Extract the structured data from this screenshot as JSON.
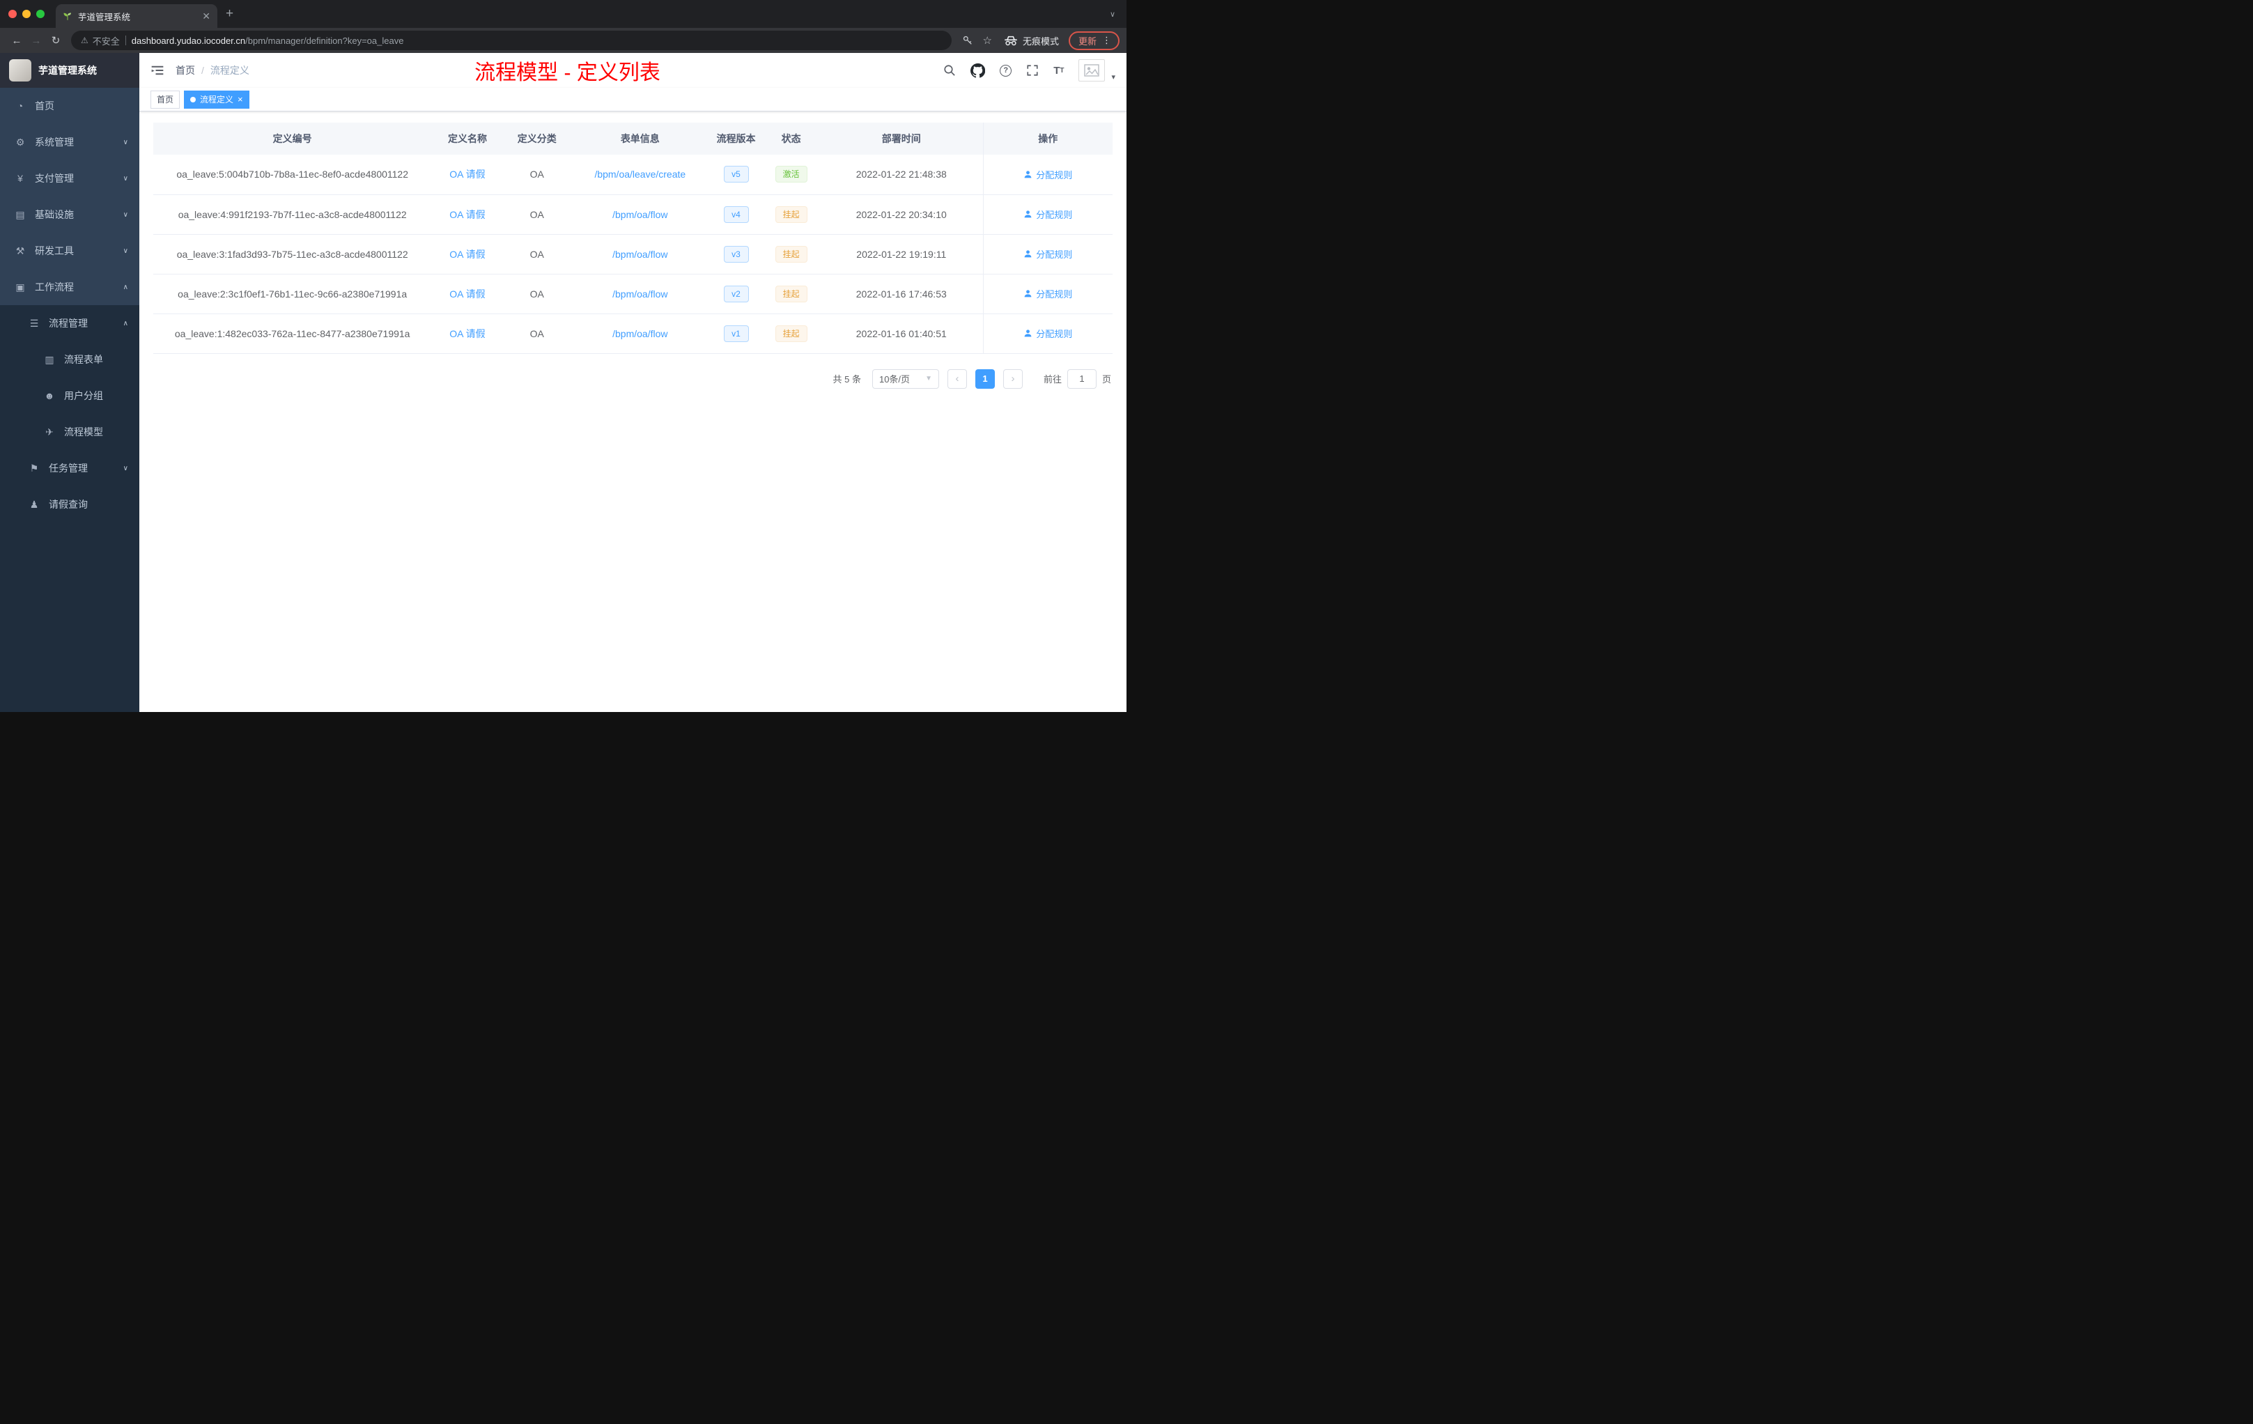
{
  "browser": {
    "tab_title": "芋道管理系统",
    "security_label": "不安全",
    "url_domain": "dashboard.yudao.iocoder.cn",
    "url_path": "/bpm/manager/definition?key=oa_leave",
    "incognito_label": "无痕模式",
    "update_label": "更新"
  },
  "sidebar": {
    "app_title": "芋道管理系统",
    "menu": [
      {
        "label": "首页",
        "icon": "dashboard-icon"
      },
      {
        "label": "系统管理",
        "icon": "gear-icon"
      },
      {
        "label": "支付管理",
        "icon": "yen-icon"
      },
      {
        "label": "基础设施",
        "icon": "infrastructure-icon"
      },
      {
        "label": "研发工具",
        "icon": "tools-icon"
      },
      {
        "label": "工作流程",
        "icon": "workflow-icon"
      },
      {
        "label": "流程管理",
        "icon": "process-list-icon"
      },
      {
        "label": "流程表单",
        "icon": "form-icon"
      },
      {
        "label": "用户分组",
        "icon": "user-group-icon"
      },
      {
        "label": "流程模型",
        "icon": "paper-plane-icon"
      },
      {
        "label": "任务管理",
        "icon": "task-icon"
      },
      {
        "label": "请假查询",
        "icon": "person-icon"
      }
    ]
  },
  "header": {
    "breadcrumb_home": "首页",
    "breadcrumb_separator": "/",
    "breadcrumb_current": "流程定义",
    "annotation": "流程模型 - 定义列表"
  },
  "tags": {
    "home": "首页",
    "current": "流程定义"
  },
  "table": {
    "columns": {
      "id": "定义编号",
      "name": "定义名称",
      "category": "定义分类",
      "form": "表单信息",
      "version": "流程版本",
      "status": "状态",
      "deploy_time": "部署时间",
      "action": "操作"
    },
    "rows": [
      {
        "id": "oa_leave:5:004b710b-7b8a-11ec-8ef0-acde48001122",
        "name": "OA 请假",
        "category": "OA",
        "form": "/bpm/oa/leave/create",
        "version": "v5",
        "status": "激活",
        "status_type": "success",
        "deploy_time": "2022-01-22 21:48:38",
        "action": "分配规则"
      },
      {
        "id": "oa_leave:4:991f2193-7b7f-11ec-a3c8-acde48001122",
        "name": "OA 请假",
        "category": "OA",
        "form": "/bpm/oa/flow",
        "version": "v4",
        "status": "挂起",
        "status_type": "warning",
        "deploy_time": "2022-01-22 20:34:10",
        "action": "分配规则"
      },
      {
        "id": "oa_leave:3:1fad3d93-7b75-11ec-a3c8-acde48001122",
        "name": "OA 请假",
        "category": "OA",
        "form": "/bpm/oa/flow",
        "version": "v3",
        "status": "挂起",
        "status_type": "warning",
        "deploy_time": "2022-01-22 19:19:11",
        "action": "分配规则"
      },
      {
        "id": "oa_leave:2:3c1f0ef1-76b1-11ec-9c66-a2380e71991a",
        "name": "OA 请假",
        "category": "OA",
        "form": "/bpm/oa/flow",
        "version": "v2",
        "status": "挂起",
        "status_type": "warning",
        "deploy_time": "2022-01-16 17:46:53",
        "action": "分配规则"
      },
      {
        "id": "oa_leave:1:482ec033-762a-11ec-8477-a2380e71991a",
        "name": "OA 请假",
        "category": "OA",
        "form": "/bpm/oa/flow",
        "version": "v1",
        "status": "挂起",
        "status_type": "warning",
        "deploy_time": "2022-01-16 01:40:51",
        "action": "分配规则"
      }
    ]
  },
  "pagination": {
    "total": "共 5 条",
    "page_size": "10条/页",
    "current_page": "1",
    "goto_label": "前往",
    "goto_value": "1",
    "page_label": "页"
  },
  "colors": {
    "accent": "#409eff",
    "success": "#67c23a",
    "warning": "#e6a23c",
    "annotation_red": "#ff0000",
    "sidebar_bg": "#304156",
    "sidebar_sub_bg": "#1f2d3d"
  }
}
